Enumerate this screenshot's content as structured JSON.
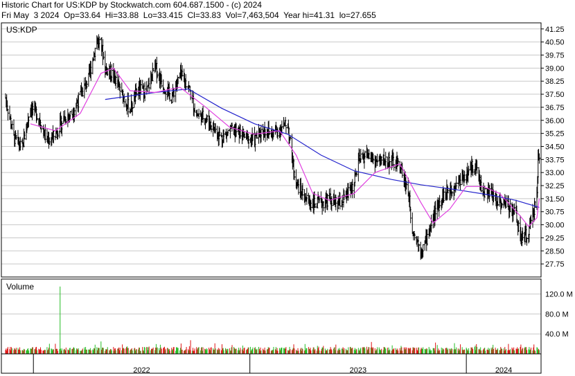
{
  "header": {
    "line1": "Historic Chart for US:KDP by Stockwatch.com 604.687.1500 - (c) 2024",
    "line2": "Fri May  3 2024  Op=33.64  Hi=33.88  Lo=33.415  Cl=33.83  Vol=7,463,504  Year hi=41.31  lo=27.655"
  },
  "chart_data": {
    "type": "line",
    "subtype": "ohlc-bars",
    "symbol": "US:KDP",
    "price_axis": {
      "ylim": [
        27.0,
        41.6
      ],
      "ticks": [
        "41.25",
        "40.50",
        "39.75",
        "39.00",
        "38.25",
        "37.50",
        "36.75",
        "36.00",
        "35.25",
        "34.50",
        "33.75",
        "33.00",
        "32.25",
        "31.50",
        "30.75",
        "30.00",
        "29.25",
        "28.50",
        "27.75"
      ]
    },
    "volume_panel": {
      "label": "Volume",
      "ylim": [
        0,
        150
      ],
      "ticks": [
        "120.0 M",
        "80.0 M",
        "40.0 M"
      ]
    },
    "x_axis": {
      "labels": [
        "2022",
        "2023",
        "2024"
      ]
    },
    "price_path": [
      [
        "2021-11-15",
        37.3
      ],
      [
        "2021-11-29",
        35.0
      ],
      [
        "2021-12-13",
        34.4
      ],
      [
        "2021-12-27",
        36.8
      ],
      [
        "2022-01-10",
        36.2
      ],
      [
        "2022-01-24",
        34.8
      ],
      [
        "2022-02-07",
        35.2
      ],
      [
        "2022-02-21",
        36.1
      ],
      [
        "2022-03-07",
        36.4
      ],
      [
        "2022-03-21",
        37.4
      ],
      [
        "2022-04-04",
        38.4
      ],
      [
        "2022-04-18",
        40.6
      ],
      [
        "2022-04-25",
        40.4
      ],
      [
        "2022-05-02",
        39.0
      ],
      [
        "2022-05-16",
        38.6
      ],
      [
        "2022-05-30",
        37.5
      ],
      [
        "2022-06-13",
        36.6
      ],
      [
        "2022-06-27",
        37.8
      ],
      [
        "2022-07-11",
        37.6
      ],
      [
        "2022-07-25",
        39.1
      ],
      [
        "2022-08-08",
        38.0
      ],
      [
        "2022-08-22",
        37.3
      ],
      [
        "2022-09-05",
        38.6
      ],
      [
        "2022-09-19",
        38.0
      ],
      [
        "2022-10-03",
        36.3
      ],
      [
        "2022-10-17",
        36.2
      ],
      [
        "2022-10-31",
        35.6
      ],
      [
        "2022-11-14",
        35.0
      ],
      [
        "2022-11-28",
        35.4
      ],
      [
        "2022-12-12",
        35.3
      ],
      [
        "2022-12-26",
        35.0
      ],
      [
        "2023-01-09",
        34.9
      ],
      [
        "2023-01-23",
        35.5
      ],
      [
        "2023-02-06",
        35.2
      ],
      [
        "2023-02-20",
        35.5
      ],
      [
        "2023-03-06",
        35.8
      ],
      [
        "2023-03-13",
        33.8
      ],
      [
        "2023-03-20",
        32.4
      ],
      [
        "2023-04-03",
        31.6
      ],
      [
        "2023-04-17",
        31.2
      ],
      [
        "2023-05-01",
        31.2
      ],
      [
        "2023-05-15",
        31.5
      ],
      [
        "2023-05-29",
        31.1
      ],
      [
        "2023-06-12",
        31.6
      ],
      [
        "2023-06-26",
        32.4
      ],
      [
        "2023-07-03",
        33.6
      ],
      [
        "2023-07-17",
        34.1
      ],
      [
        "2023-07-31",
        33.6
      ],
      [
        "2023-08-14",
        33.7
      ],
      [
        "2023-08-28",
        33.6
      ],
      [
        "2023-09-11",
        33.4
      ],
      [
        "2023-09-25",
        31.9
      ],
      [
        "2023-10-02",
        29.8
      ],
      [
        "2023-10-16",
        28.6
      ],
      [
        "2023-10-23",
        28.9
      ],
      [
        "2023-11-06",
        30.4
      ],
      [
        "2023-11-20",
        31.6
      ],
      [
        "2023-12-04",
        32.0
      ],
      [
        "2023-12-18",
        32.5
      ],
      [
        "2024-01-01",
        32.9
      ],
      [
        "2024-01-15",
        33.5
      ],
      [
        "2024-01-29",
        31.9
      ],
      [
        "2024-02-12",
        31.8
      ],
      [
        "2024-02-26",
        31.3
      ],
      [
        "2024-03-11",
        31.2
      ],
      [
        "2024-03-25",
        30.6
      ],
      [
        "2024-04-01",
        29.2
      ],
      [
        "2024-04-15",
        29.5
      ],
      [
        "2024-04-22",
        30.6
      ],
      [
        "2024-04-29",
        31.7
      ],
      [
        "2024-05-01",
        33.9
      ],
      [
        "2024-05-03",
        33.8
      ]
    ],
    "moving_average_short": [
      [
        "2021-12-27",
        35.8
      ],
      [
        "2022-02-07",
        35.4
      ],
      [
        "2022-03-21",
        36.4
      ],
      [
        "2022-04-25",
        38.7
      ],
      [
        "2022-05-16",
        39.0
      ],
      [
        "2022-06-13",
        37.7
      ],
      [
        "2022-07-25",
        37.6
      ],
      [
        "2022-09-05",
        37.9
      ],
      [
        "2022-10-17",
        36.8
      ],
      [
        "2022-11-28",
        35.6
      ],
      [
        "2023-01-09",
        35.2
      ],
      [
        "2023-02-20",
        35.4
      ],
      [
        "2023-03-20",
        34.0
      ],
      [
        "2023-04-17",
        31.8
      ],
      [
        "2023-05-15",
        31.4
      ],
      [
        "2023-06-26",
        31.8
      ],
      [
        "2023-07-31",
        33.0
      ],
      [
        "2023-09-11",
        33.5
      ],
      [
        "2023-10-16",
        31.3
      ],
      [
        "2023-11-06",
        30.1
      ],
      [
        "2023-12-04",
        30.9
      ],
      [
        "2024-01-01",
        32.2
      ],
      [
        "2024-01-29",
        32.2
      ],
      [
        "2024-02-26",
        31.8
      ],
      [
        "2024-04-01",
        30.5
      ],
      [
        "2024-04-15",
        29.9
      ],
      [
        "2024-04-29",
        30.4
      ],
      [
        "2024-05-03",
        31.5
      ]
    ],
    "moving_average_long": [
      [
        "2022-05-02",
        37.2
      ],
      [
        "2022-07-25",
        37.6
      ],
      [
        "2022-09-19",
        37.8
      ],
      [
        "2022-11-14",
        36.7
      ],
      [
        "2023-01-09",
        35.8
      ],
      [
        "2023-03-06",
        35.2
      ],
      [
        "2023-05-01",
        34.0
      ],
      [
        "2023-06-26",
        33.1
      ],
      [
        "2023-08-28",
        32.6
      ],
      [
        "2023-10-16",
        32.3
      ],
      [
        "2023-12-18",
        32.0
      ],
      [
        "2024-02-12",
        31.7
      ],
      [
        "2024-03-25",
        31.4
      ],
      [
        "2024-05-03",
        31.0
      ]
    ],
    "volume_spike": {
      "date": "2022-02-15",
      "value": 135
    },
    "colors": {
      "bars": "#000000",
      "ma_short": "#e040e0",
      "ma_long": "#2222cc",
      "vol_up": "#22bb22",
      "vol_down": "#dd1111",
      "grid": "#c8c8c8"
    }
  }
}
